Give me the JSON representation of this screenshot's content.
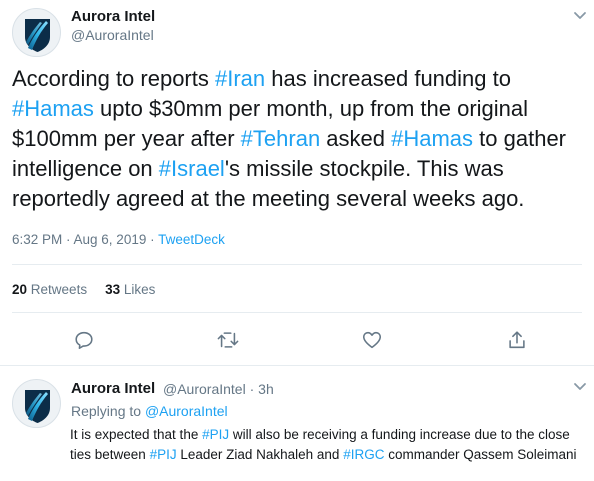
{
  "main_tweet": {
    "author_name": "Aurora Intel",
    "author_handle": "@AuroraIntel",
    "body": [
      {
        "t": "According to reports "
      },
      {
        "t": "#Iran",
        "h": true
      },
      {
        "t": " has increased funding to "
      },
      {
        "t": "#Hamas",
        "h": true
      },
      {
        "t": " upto  $30mm per month, up from the original $100mm per year after "
      },
      {
        "t": "#Tehran",
        "h": true
      },
      {
        "t": " asked "
      },
      {
        "t": "#Hamas",
        "h": true
      },
      {
        "t": " to gather intelligence on "
      },
      {
        "t": "#Israel",
        "h": true
      },
      {
        "t": "'s missile stockpile. This was reportedly agreed at the meeting several weeks ago."
      }
    ],
    "time": "6:32 PM · Aug 6, 2019 · ",
    "via": "TweetDeck",
    "retweets_count": "20",
    "retweets_label": "Retweets",
    "likes_count": "33",
    "likes_label": "Likes"
  },
  "actions": {
    "icons": [
      "reply-icon",
      "retweet-icon",
      "like-icon",
      "share-icon"
    ]
  },
  "reply_tweet": {
    "author_name": "Aurora Intel",
    "author_handle": "@AuroraIntel",
    "time": "3h",
    "replying_prefix": "Replying to ",
    "replying_to": "@AuroraIntel",
    "body": [
      {
        "t": "It is expected that the "
      },
      {
        "t": "#PIJ",
        "h": true
      },
      {
        "t": " will also be receiving a funding increase due to the close ties between "
      },
      {
        "t": "#PIJ",
        "h": true
      },
      {
        "t": " Leader Ziad Nakhaleh and "
      },
      {
        "t": "#IRGC",
        "h": true
      },
      {
        "t": " commander Qassem Soleimani"
      }
    ]
  },
  "colors": {
    "accent": "#1da1f2",
    "text": "#14171a",
    "muted": "#657786",
    "border": "#e6ecf0"
  }
}
